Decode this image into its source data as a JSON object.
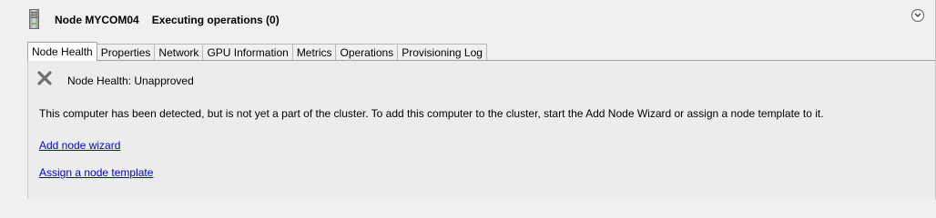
{
  "header": {
    "node_title": "Node MYCOM04",
    "operations_status": "Executing operations (0)",
    "icon": "server-icon",
    "collapse_icon": "chevron-down-icon"
  },
  "tabs": [
    {
      "label": "Node Health",
      "active": true
    },
    {
      "label": "Properties",
      "active": false
    },
    {
      "label": "Network",
      "active": false
    },
    {
      "label": "GPU Information",
      "active": false
    },
    {
      "label": "Metrics",
      "active": false
    },
    {
      "label": "Operations",
      "active": false
    },
    {
      "label": "Provisioning Log",
      "active": false
    }
  ],
  "health": {
    "icon": "close-icon",
    "status_text": "Node Health: Unapproved",
    "description": "This computer has been detected, but is not yet a part of the cluster. To add this computer to the cluster, start the Add Node Wizard or assign a node template to it.",
    "links": {
      "add_node": "Add node wizard",
      "assign_template": "Assign a node template"
    }
  },
  "colors": {
    "background": "#f0f0f0",
    "link": "#0000ee",
    "panel": "#ececec"
  }
}
